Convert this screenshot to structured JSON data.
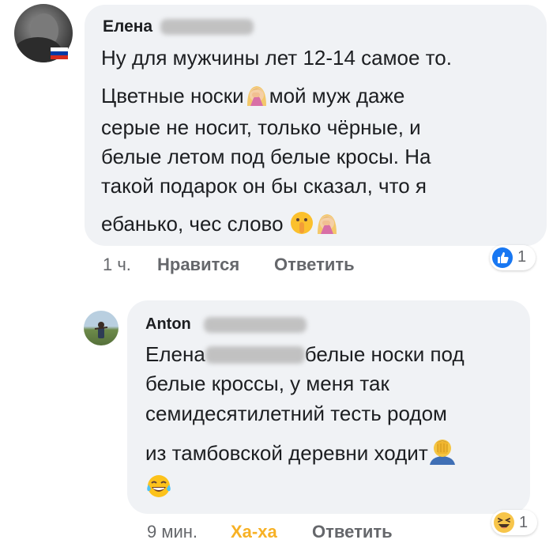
{
  "comment1": {
    "author": "Елена",
    "lines": [
      "Ну для мужчины лет 12-14 самое то.",
      "Цветные носки",
      "мой муж даже",
      "серые не носит, только чёрные, и",
      "белые летом под белые кросы. На",
      "такой подарок он бы сказал, что я",
      "ебанько, чес слово"
    ],
    "time": "1 ч.",
    "like": "Нравится",
    "reply": "Ответить",
    "reaction_count": "1",
    "flag_colors": [
      "#ffffff",
      "#0039a6",
      "#d52b1e"
    ]
  },
  "comment2": {
    "author": "Anton",
    "lines": [
      "Елена",
      "белые носки под",
      "белые кроссы, у меня так",
      "семидесятилетний тесть родом",
      "из тамбовской деревни ходит"
    ],
    "time": "9 мин.",
    "haha": "Ха-ха",
    "reply": "Ответить",
    "reaction_count": "1"
  },
  "colors": {
    "bubble": "#f0f2f5",
    "text": "#1c1e21",
    "meta": "#65676b",
    "haha": "#f7b125",
    "like_blue": "#1877f2"
  },
  "icons": [
    "facepalm-woman-icon",
    "shushing-face-icon",
    "facepalm-man-icon",
    "tears-of-joy-icon",
    "like-reaction-icon",
    "haha-reaction-icon"
  ]
}
